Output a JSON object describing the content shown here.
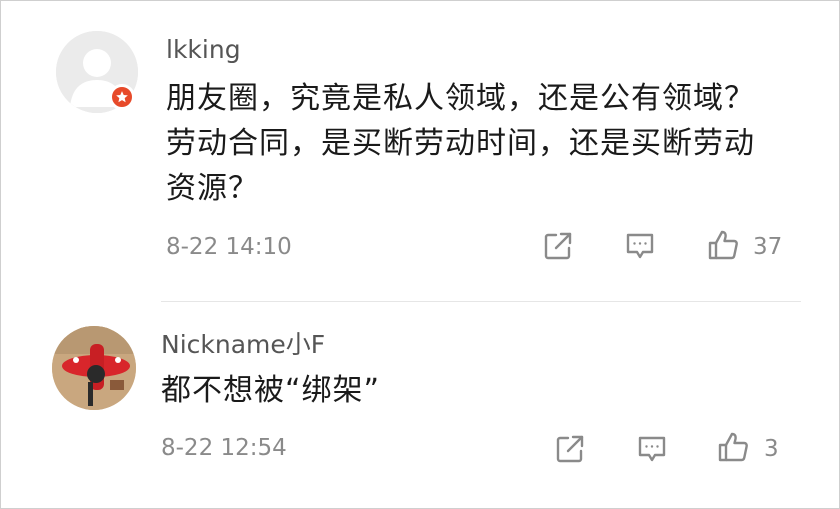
{
  "comments": [
    {
      "username": "lkking",
      "content_lines": [
        "朋友圈，究竟是私人领域，还是公有领域？",
        "劳动合同，是买断劳动时间，还是买断劳动",
        "资源？"
      ],
      "time": "8-22 14:10",
      "likes": "37",
      "avatar_icon": "default-user-avatar-icon",
      "badge_icon": "verified-star-badge-icon"
    },
    {
      "username": "Nickname小F",
      "content_lines": [
        "都不想被“绑架”"
      ],
      "time": "8-22 12:54",
      "likes": "3",
      "avatar_icon": "user-photo-avatar"
    }
  ],
  "icons": {
    "share": "share-icon",
    "reply": "reply-icon",
    "like": "thumbs-up-icon"
  },
  "colors": {
    "badge": "#e74a2a",
    "text_primary": "#1a1a1a",
    "text_secondary": "#8a8a8a",
    "divider": "#e6e6e6"
  }
}
